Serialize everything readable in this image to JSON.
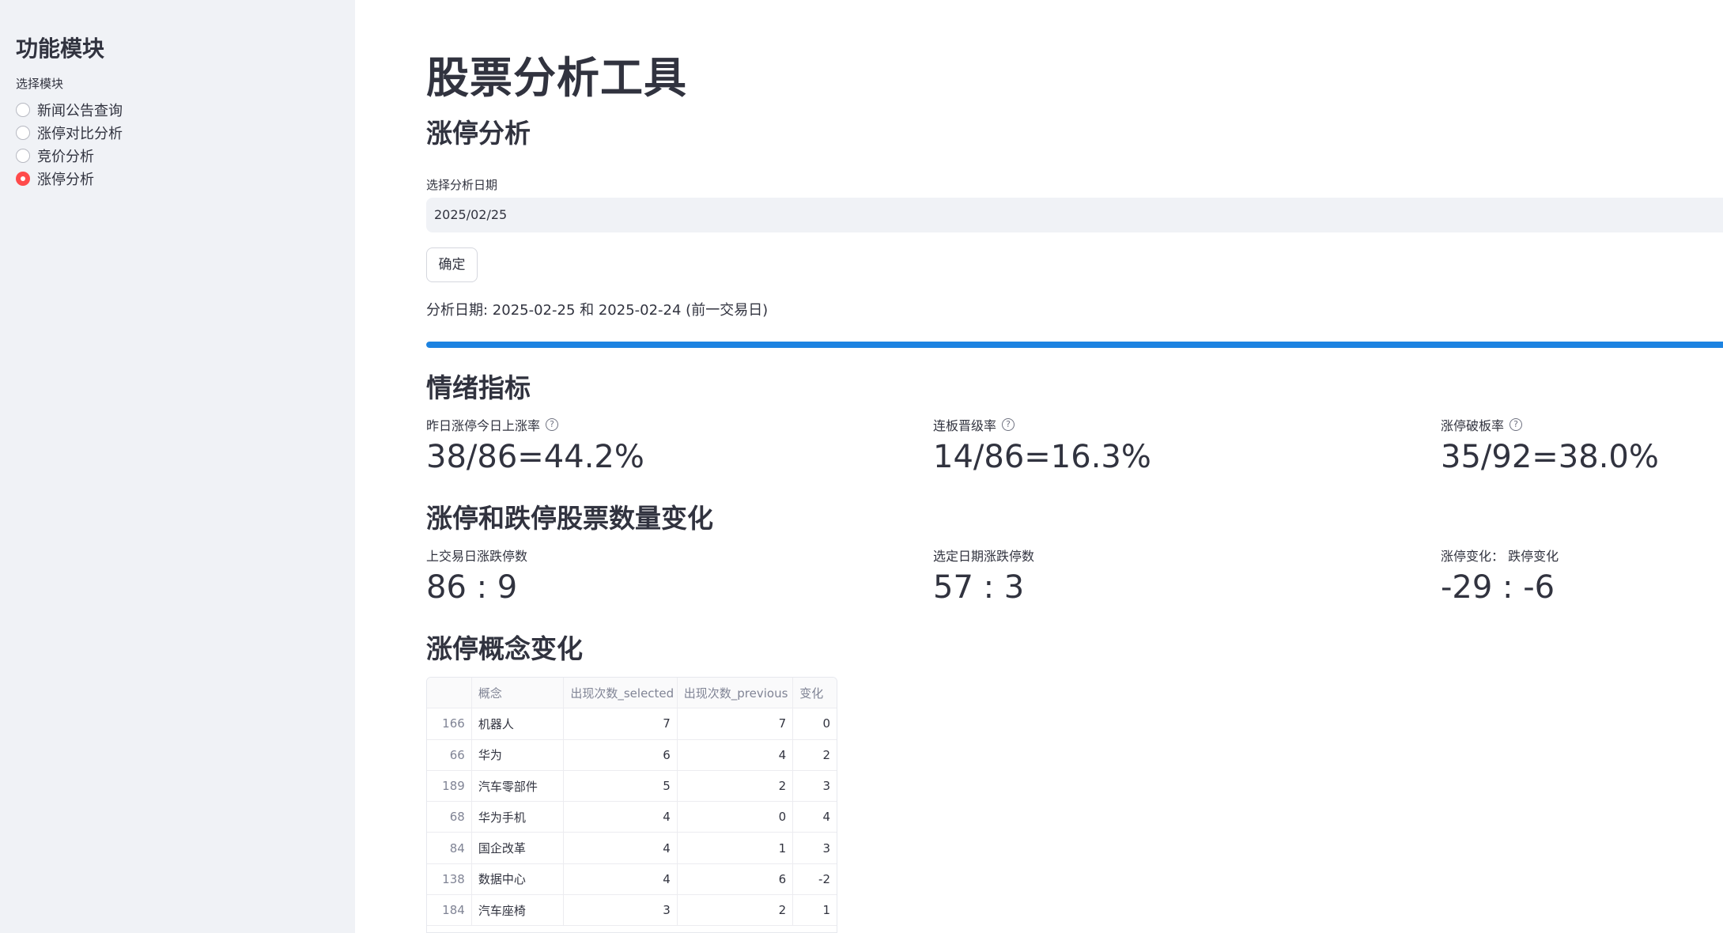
{
  "sidebar": {
    "title": "功能模块",
    "radio_label": "选择模块",
    "options": [
      {
        "label": "新闻公告查询",
        "selected": false
      },
      {
        "label": "涨停对比分析",
        "selected": false
      },
      {
        "label": "竞价分析",
        "selected": false
      },
      {
        "label": "涨停分析",
        "selected": true
      }
    ]
  },
  "main": {
    "title": "股票分析工具",
    "section_title": "涨停分析",
    "date_label": "选择分析日期",
    "date_value": "2025/02/25",
    "confirm_label": "确定",
    "analysis_info": "分析日期: 2025-02-25 和 2025-02-24 (前一交易日)",
    "progress_fraction": 1.0,
    "sentiment": {
      "title": "情绪指标",
      "metrics": [
        {
          "label": "昨日涨停今日上涨率",
          "value": "38/86=44.2%",
          "help_icon": "question-circle-icon"
        },
        {
          "label": "连板晋级率",
          "value": "14/86=16.3%",
          "help_icon": "question-circle-icon"
        },
        {
          "label": "涨停破板率",
          "value": "35/92=38.0%",
          "help_icon": "question-circle-icon"
        }
      ]
    },
    "counts": {
      "title": "涨停和跌停股票数量变化",
      "metrics": [
        {
          "label": "上交易日涨跌停数",
          "value": "86 : 9"
        },
        {
          "label": "选定日期涨跌停数",
          "value": "57 : 3"
        },
        {
          "label": "涨停变化： 跌停变化",
          "value": "-29 : -6"
        }
      ]
    },
    "concepts": {
      "title": "涨停概念变化",
      "columns": [
        "",
        "概念",
        "出现次数_selected",
        "出现次数_previous",
        "变化"
      ],
      "rows": [
        [
          "166",
          "机器人",
          "7",
          "7",
          "0"
        ],
        [
          "66",
          "华为",
          "6",
          "4",
          "2"
        ],
        [
          "189",
          "汽车零部件",
          "5",
          "2",
          "3"
        ],
        [
          "68",
          "华为手机",
          "4",
          "0",
          "4"
        ],
        [
          "84",
          "国企改革",
          "4",
          "1",
          "3"
        ],
        [
          "138",
          "数据中心",
          "4",
          "6",
          "-2"
        ],
        [
          "184",
          "汽车座椅",
          "3",
          "2",
          "1"
        ]
      ]
    }
  },
  "colors": {
    "accent": "#ff4b4b",
    "progress": "#1c83e1",
    "sidebar_bg": "#f0f2f6"
  }
}
